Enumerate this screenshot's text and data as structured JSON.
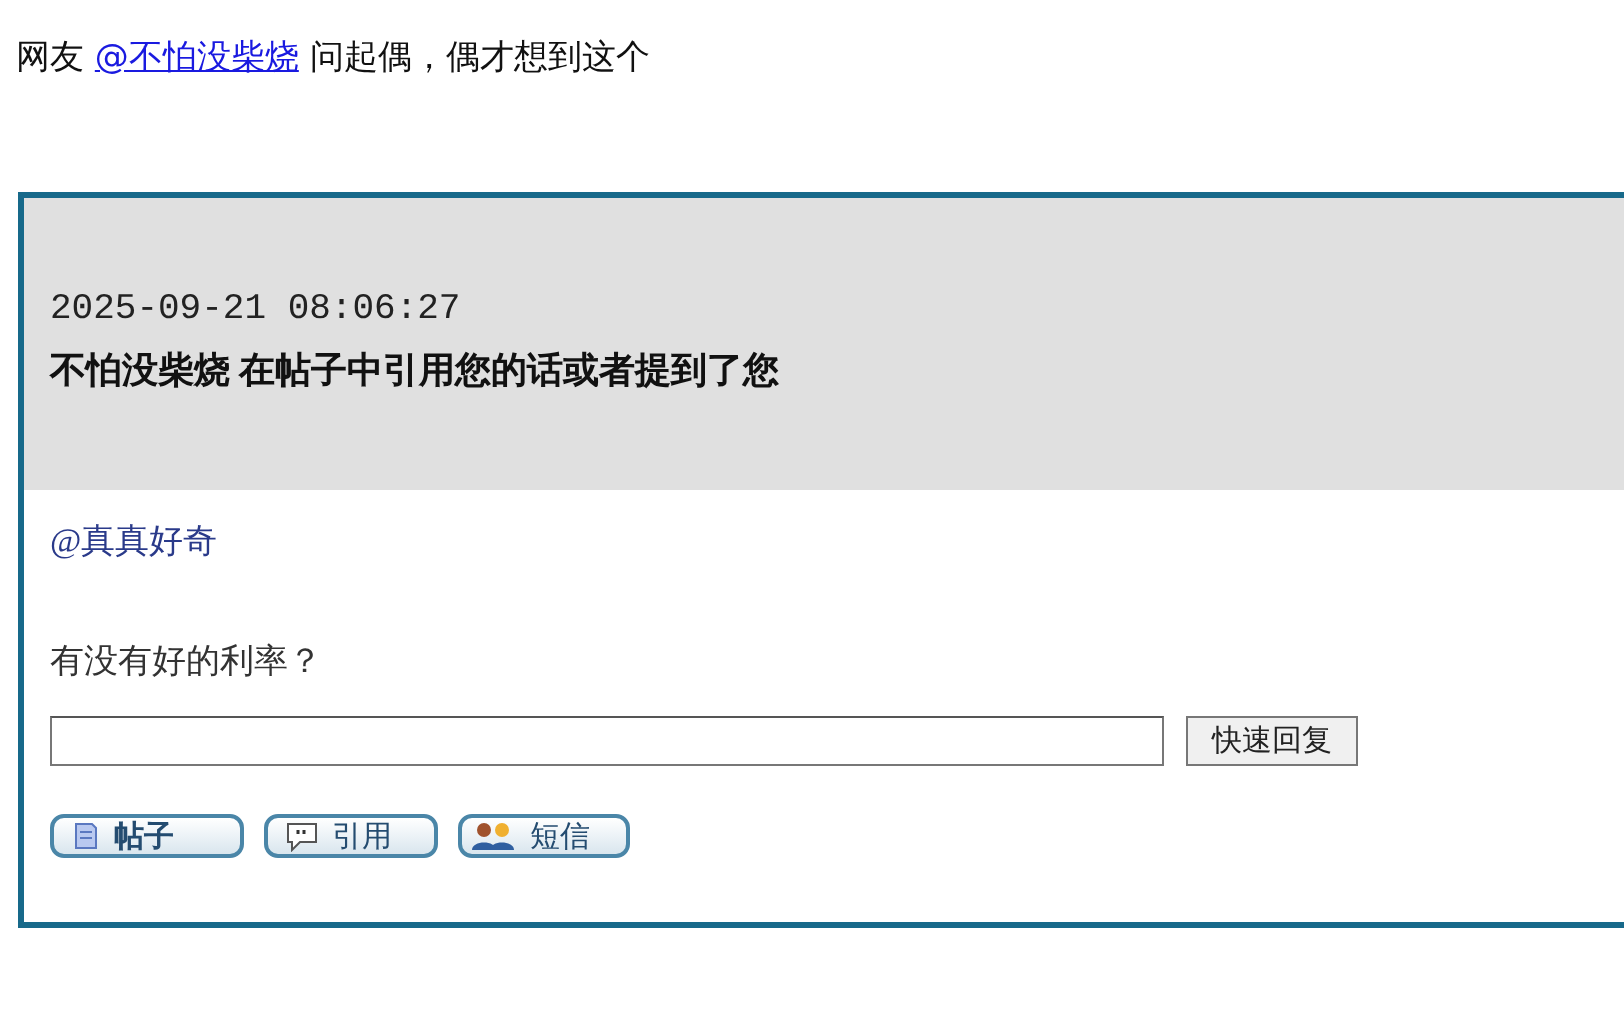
{
  "intro": {
    "before": "网友 ",
    "link": "@不怕没柴烧",
    "after": " 问起偶，偶才想到这个"
  },
  "notice": {
    "time": "2025-09-21 08:06:27",
    "headline": "不怕没柴烧 在帖子中引用您的话或者提到了您"
  },
  "quote": {
    "mention": "@真真好奇",
    "message": "有没有好的利率？"
  },
  "reply": {
    "button": "快速回复"
  },
  "actions": [
    {
      "kind": "post",
      "label": "帖子"
    },
    {
      "kind": "quote",
      "label": "引用"
    },
    {
      "kind": "message",
      "label": "短信"
    }
  ]
}
